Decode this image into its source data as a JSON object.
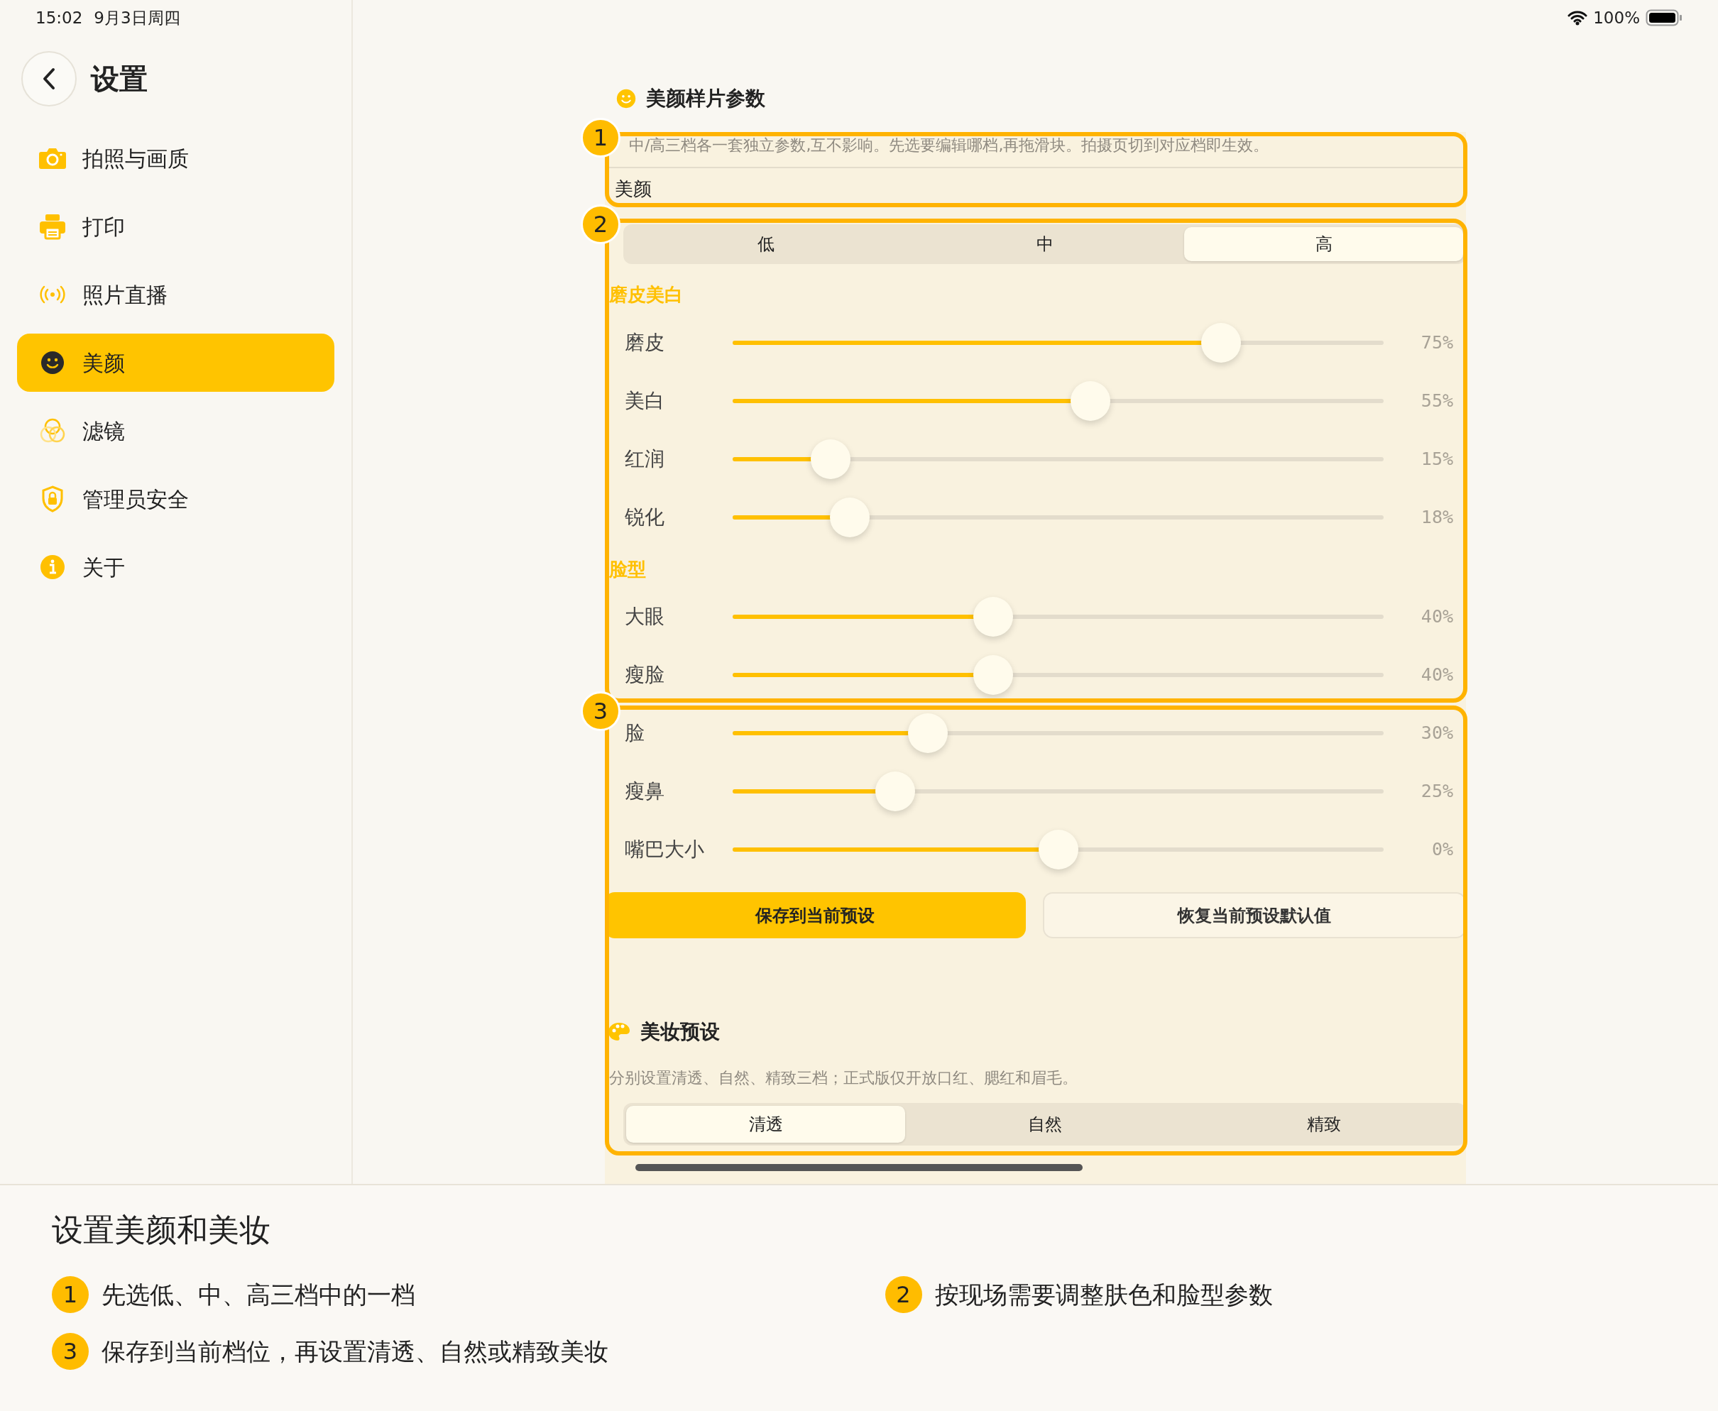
{
  "status_bar": {
    "time": "15:02",
    "date": "9月3日周四",
    "battery": "100%"
  },
  "sidebar": {
    "title": "设置",
    "items": [
      {
        "label": "拍照与画质",
        "selected": false
      },
      {
        "label": "打印",
        "selected": false
      },
      {
        "label": "照片直播",
        "selected": false
      },
      {
        "label": "美颜",
        "selected": true
      },
      {
        "label": "滤镜",
        "selected": false
      },
      {
        "label": "管理员安全",
        "selected": false
      },
      {
        "label": "关于",
        "selected": false
      }
    ]
  },
  "beauty": {
    "title": "美颜样片参数",
    "description": "中/高三档各一套独立参数,互不影响。先选要编辑哪档,再拖滑块。拍摄页切到对应档即生效。",
    "label": "美颜",
    "levels": [
      {
        "label": "低",
        "selected": false
      },
      {
        "label": "中",
        "selected": false
      },
      {
        "label": "高",
        "selected": true
      }
    ],
    "groups": [
      {
        "title": "磨皮美白",
        "sliders": [
          {
            "name": "磨皮",
            "level": 0.75,
            "reading": "75%"
          },
          {
            "name": "美白",
            "level": 0.55,
            "reading": "55%"
          },
          {
            "name": "红润",
            "level": 0.15,
            "reading": "15%"
          },
          {
            "name": "锐化",
            "level": 0.18,
            "reading": "18%"
          }
        ]
      },
      {
        "title": "脸型",
        "sliders": [
          {
            "name": "大眼",
            "level": 0.4,
            "reading": "40%"
          },
          {
            "name": "瘦脸",
            "level": 0.4,
            "reading": "40%"
          },
          {
            "name": "脸",
            "level": 0.3,
            "reading": "30%"
          },
          {
            "name": "瘦鼻",
            "level": 0.25,
            "reading": "25%"
          },
          {
            "name": "嘴巴大小",
            "level": 0.5,
            "reading": "0%"
          }
        ]
      }
    ],
    "buttons": [
      {
        "label": "保存到当前预设",
        "kind": "primary"
      },
      {
        "label": "恢复当前预设默认值",
        "kind": "secondary"
      }
    ]
  },
  "makeup": {
    "title": "美妆预设",
    "description": "分别设置清透、自然、精致三档；正式版仅开放口红、腮红和眉毛。",
    "styles": [
      {
        "label": "清透",
        "selected": true
      },
      {
        "label": "自然",
        "selected": false
      },
      {
        "label": "精致",
        "selected": false
      }
    ]
  },
  "callouts": [
    {
      "number": "1"
    },
    {
      "number": "2"
    },
    {
      "number": "3"
    }
  ],
  "guide": {
    "title": "设置美颜和美妆",
    "steps": [
      {
        "number": "1",
        "text": "先选低、中、高三档中的一档"
      },
      {
        "number": "2",
        "text": "按现场需要调整肤色和脸型参数"
      },
      {
        "number": "3",
        "text": "保存到当前档位，再设置清透、自然或精致美妆"
      }
    ]
  }
}
